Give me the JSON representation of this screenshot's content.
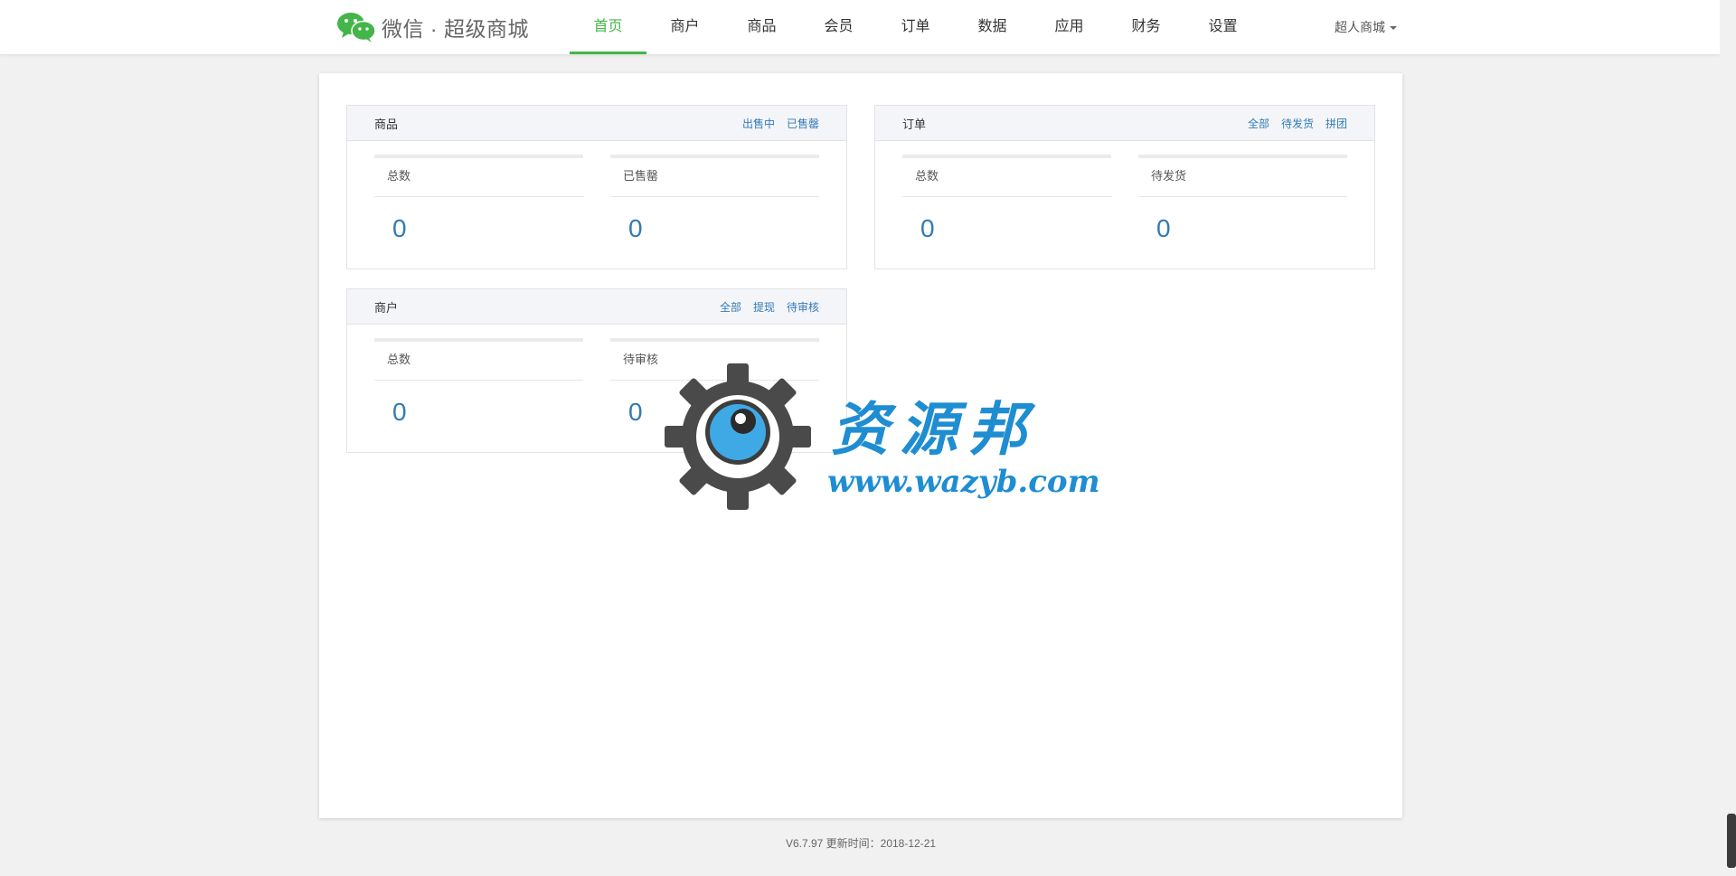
{
  "header": {
    "brand": "微信 · 超级商城",
    "nav": [
      "首页",
      "商户",
      "商品",
      "会员",
      "订单",
      "数据",
      "应用",
      "财务",
      "设置"
    ],
    "active_nav": "首页",
    "user_menu": "超人商城"
  },
  "cards": {
    "goods": {
      "title": "商品",
      "links": [
        "出售中",
        "已售罄"
      ],
      "stats": [
        {
          "label": "总数",
          "value": "0"
        },
        {
          "label": "已售罄",
          "value": "0"
        }
      ]
    },
    "orders": {
      "title": "订单",
      "links": [
        "全部",
        "待发货",
        "拼团"
      ],
      "stats": [
        {
          "label": "总数",
          "value": "0"
        },
        {
          "label": "待发货",
          "value": "0"
        }
      ]
    },
    "merchants": {
      "title": "商户",
      "links": [
        "全部",
        "提现",
        "待审核"
      ],
      "stats": [
        {
          "label": "总数",
          "value": "0"
        },
        {
          "label": "待审核",
          "value": "0"
        }
      ]
    }
  },
  "watermark": {
    "title": "资源邦",
    "url": "www.wazyb.com"
  },
  "footer": {
    "version": "V6.7.97 更新时间：2018-12-21"
  },
  "colors": {
    "brand_green": "#44b549",
    "link_blue": "#337ab7"
  }
}
